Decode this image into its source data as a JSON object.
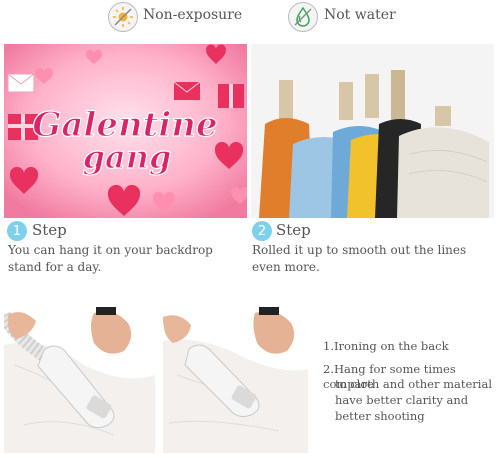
{
  "top": {
    "nonexposure_label": "Non-exposure",
    "notwater_label": "Not water"
  },
  "banner": {
    "line1": "Galentine",
    "line2": "gang"
  },
  "step1": {
    "number": "1",
    "title": "Step",
    "desc_line1": "You can hang it on your backdrop",
    "desc_line2": "stand for a day."
  },
  "step2": {
    "number": "2",
    "title": "Step",
    "desc_line1": "Rolled it up to smooth out the lines",
    "desc_line2": "even more."
  },
  "instructions": {
    "item1": "1.Ironing on the back",
    "item2_line1": "2.Hang for some times compare",
    "item2_line2": "to cloth and other material",
    "item2_line3": "have better clarity and",
    "item2_line4": "better shooting"
  },
  "colors": {
    "accent": "#7fd0ec",
    "banner_pink": "#f06a9a",
    "text": "#555555"
  }
}
